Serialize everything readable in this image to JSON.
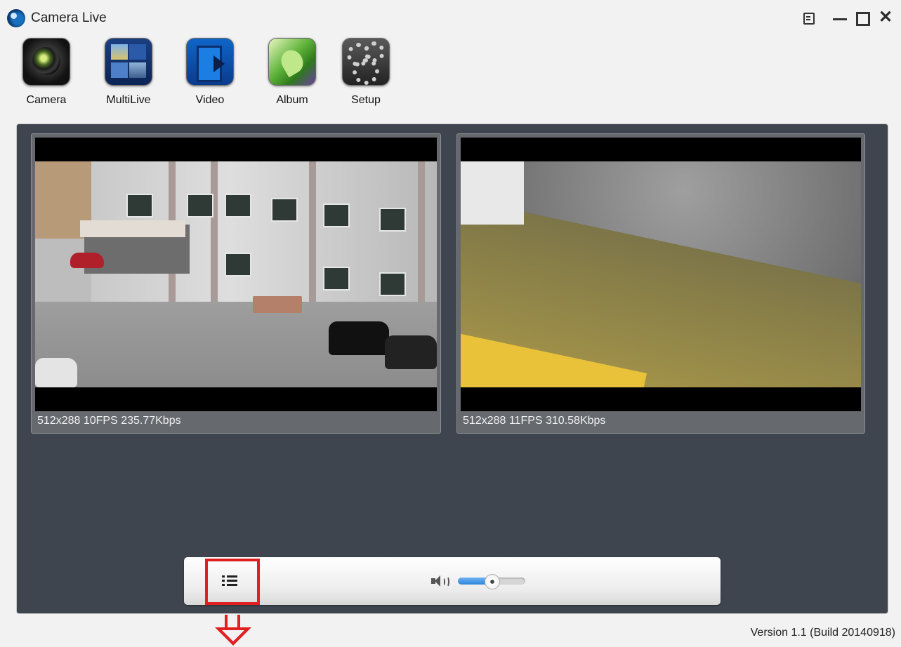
{
  "window": {
    "title": "Camera Live",
    "icons": [
      "app-logo-icon",
      "menu-icon",
      "minimize-icon",
      "maximize-icon",
      "close-icon"
    ],
    "close_glyph": "✕"
  },
  "toolbar": {
    "items": [
      {
        "label": "Camera",
        "icon": "camera-icon"
      },
      {
        "label": "MultiLive",
        "icon": "multilive-icon"
      },
      {
        "label": "Video",
        "icon": "video-icon"
      },
      {
        "label": "Album",
        "icon": "album-icon"
      },
      {
        "label": "Setup",
        "icon": "setup-gear-icon"
      }
    ]
  },
  "tiles": [
    {
      "stats": "512x288  10FPS 235.77Kbps"
    },
    {
      "stats": "512x288  11FPS 310.58Kbps"
    }
  ],
  "controls": {
    "list_icon": "list-icon",
    "volume_icon": "volume-icon",
    "volume_level": 0.5,
    "highlight_color": "#e02020"
  },
  "footer": {
    "version": "Version 1.1 (Build 20140918)"
  },
  "colors": {
    "panel": "#3e454e",
    "tile": "#666a6e",
    "slider_fill": "#2f86db"
  }
}
